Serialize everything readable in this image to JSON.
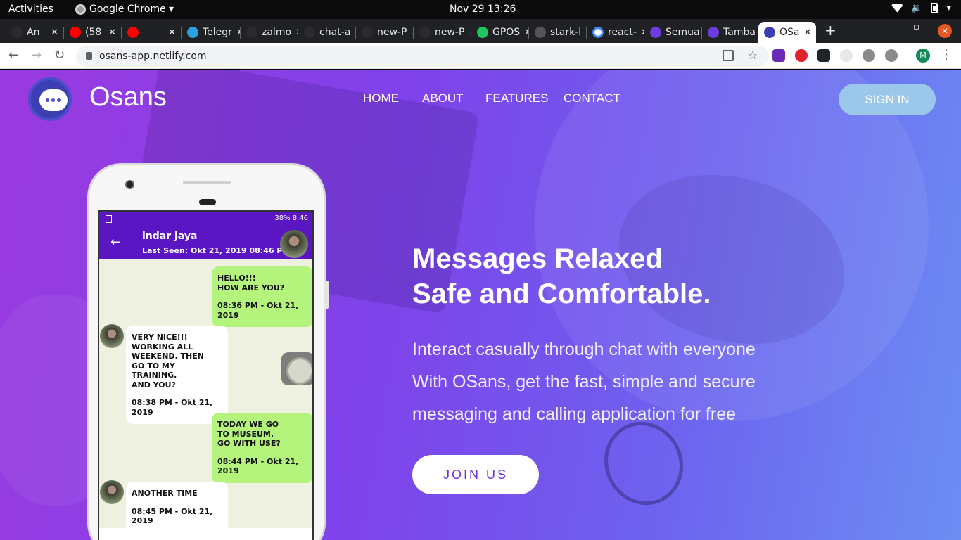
{
  "system_bar": {
    "activities": "Activities",
    "app_name": "Google Chrome ▾",
    "clock": "Nov 29  13:26"
  },
  "tabs": [
    {
      "label": "An",
      "favicon": "github-icon",
      "color": "#2b2b2b"
    },
    {
      "label": "(58",
      "favicon": "youtube-icon",
      "color": "#ff0000"
    },
    {
      "label": "",
      "favicon": "youtube-icon",
      "color": "#ff0000"
    },
    {
      "label": "Telegr",
      "favicon": "telegram-icon",
      "color": "#2aa3df"
    },
    {
      "label": "zalmo",
      "favicon": "github-icon",
      "color": "#2b2b2b"
    },
    {
      "label": "chat-a",
      "favicon": "github-icon",
      "color": "#2b2b2b"
    },
    {
      "label": "new-P",
      "favicon": "github-icon",
      "color": "#2b2b2b"
    },
    {
      "label": "new-P",
      "favicon": "github-icon",
      "color": "#2b2b2b"
    },
    {
      "label": "GPOS",
      "favicon": "gpos-icon",
      "color": "#1ec760"
    },
    {
      "label": "stark-l",
      "favicon": "globe-icon",
      "color": "#555555"
    },
    {
      "label": "react-",
      "favicon": "google-icon",
      "color": "#ffffff"
    },
    {
      "label": "Semua",
      "favicon": "c-icon",
      "color": "#6d3ce0"
    },
    {
      "label": "Tamba",
      "favicon": "c-icon",
      "color": "#6d3ce0"
    },
    {
      "label": "OSa",
      "favicon": "osans-icon",
      "color": "#3b3fb3"
    }
  ],
  "address": {
    "url": "osans-app.netlify.com"
  },
  "account": {
    "initial": "M"
  },
  "site": {
    "brand": "Osans",
    "nav": [
      "HOME",
      "ABOUT",
      "FEATURES",
      "CONTACT"
    ],
    "signin": "SIGN IN",
    "headline_line1": "Messages Relaxed",
    "headline_line2": "Safe and Comfortable.",
    "sub_lines": [
      "Interact casually through chat with everyone",
      "With OSans, get the fast, simple and secure",
      "messaging and calling application for free"
    ],
    "join": "JOIN US",
    "accent_color": "#7f42ea"
  },
  "phone": {
    "status": "38%  8.46",
    "contact_name": "indar jaya",
    "last_seen": "Last Seen: Okt 21, 2019 08:46 PM",
    "messages": [
      {
        "dir": "out",
        "lines": [
          "HELLO!!!",
          "HOW ARE YOU?"
        ],
        "time": "08:36 PM - Okt 21, 2019"
      },
      {
        "dir": "in",
        "lines": [
          "VERY NICE!!!",
          "WORKING ALL",
          "WEEKEND. THEN",
          "GO TO MY TRAINING.",
          "AND YOU?"
        ],
        "time": "08:38 PM - Okt 21, 2019"
      },
      {
        "dir": "out",
        "lines": [
          "TODAY WE GO",
          "TO MUSEUM.",
          "GO WITH USE?"
        ],
        "time": "08:44 PM - Okt 21, 2019"
      },
      {
        "dir": "in",
        "lines": [
          "ANOTHER TIME"
        ],
        "time": "08:45 PM - Okt 21, 2019"
      }
    ]
  }
}
